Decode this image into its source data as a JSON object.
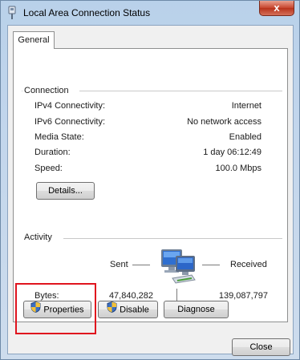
{
  "window": {
    "title": "Local Area Connection Status",
    "close_label": "x"
  },
  "tabs": [
    {
      "label": "General"
    }
  ],
  "connection": {
    "group_label": "Connection",
    "rows": [
      {
        "label": "IPv4 Connectivity:",
        "value": "Internet"
      },
      {
        "label": "IPv6 Connectivity:",
        "value": "No network access"
      },
      {
        "label": "Media State:",
        "value": "Enabled"
      },
      {
        "label": "Duration:",
        "value": "1 day 06:12:49"
      },
      {
        "label": "Speed:",
        "value": "100.0 Mbps"
      }
    ],
    "details_button": "Details..."
  },
  "activity": {
    "group_label": "Activity",
    "sent_label": "Sent",
    "received_label": "Received",
    "bytes_label": "Bytes:",
    "bytes_sent": "47,840,282",
    "bytes_received": "139,087,797"
  },
  "buttons": {
    "properties": "Properties",
    "disable": "Disable",
    "diagnose": "Diagnose",
    "close": "Close"
  },
  "colors": {
    "highlight": "#e0141e"
  }
}
